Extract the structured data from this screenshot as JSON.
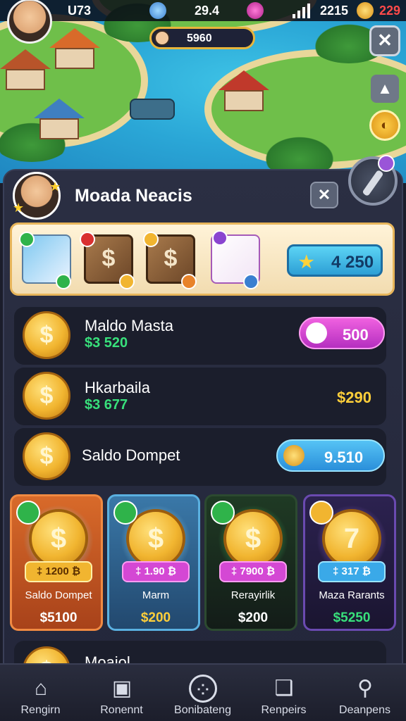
{
  "hud": {
    "level_value": "U73",
    "center_value": "29.4",
    "right_value": "2215",
    "red_value": "229",
    "xp_value": "5960"
  },
  "panel": {
    "title": "Moada Neacis",
    "rewards_total": "4 250"
  },
  "rows": [
    {
      "name": "Maldo Masta",
      "sub": "$3 520",
      "pill_value": "500",
      "pill_color": "magenta"
    },
    {
      "name": "Hkarbaila",
      "sub": "$3 677",
      "plain_value": "$290"
    },
    {
      "name": "Saldo Dompet",
      "pill_value": "9.510",
      "pill_color": "blue"
    }
  ],
  "cards": [
    {
      "price": "‡ 1200 ₿",
      "label": "Saldo Dompet",
      "value": "$5100",
      "value_color": "#ffffff",
      "theme": "#c55a22"
    },
    {
      "price": "‡ 1.90 ₿",
      "label": "Marm",
      "value": "$200",
      "value_color": "#ffcf3a",
      "theme": "#2b5d86"
    },
    {
      "price": "‡ 7900 ₿",
      "label": "Rerayirlik",
      "value": "$200",
      "value_color": "#ffffff",
      "theme": "#1e3a22"
    },
    {
      "price": "‡ 317 ₿",
      "label": "Maza Rarants",
      "value": "$5250",
      "value_color": "#38e07b",
      "theme": "#2a2148"
    }
  ],
  "peek_row": {
    "name": "Moajol"
  },
  "nav": [
    {
      "label": "Rengirn",
      "icon": "home-icon"
    },
    {
      "label": "Ronennt",
      "icon": "chat-icon"
    },
    {
      "label": "Bonibateng",
      "icon": "cookie-icon"
    },
    {
      "label": "Renpeirs",
      "icon": "book-icon"
    },
    {
      "label": "Deanpens",
      "icon": "search-icon"
    }
  ],
  "colors": {
    "accent_gold": "#f1b530",
    "panel_bg": "#2b2f43",
    "money_green": "#38e07b",
    "pill_magenta": "#d448d4",
    "pill_blue": "#3aa9e8"
  }
}
